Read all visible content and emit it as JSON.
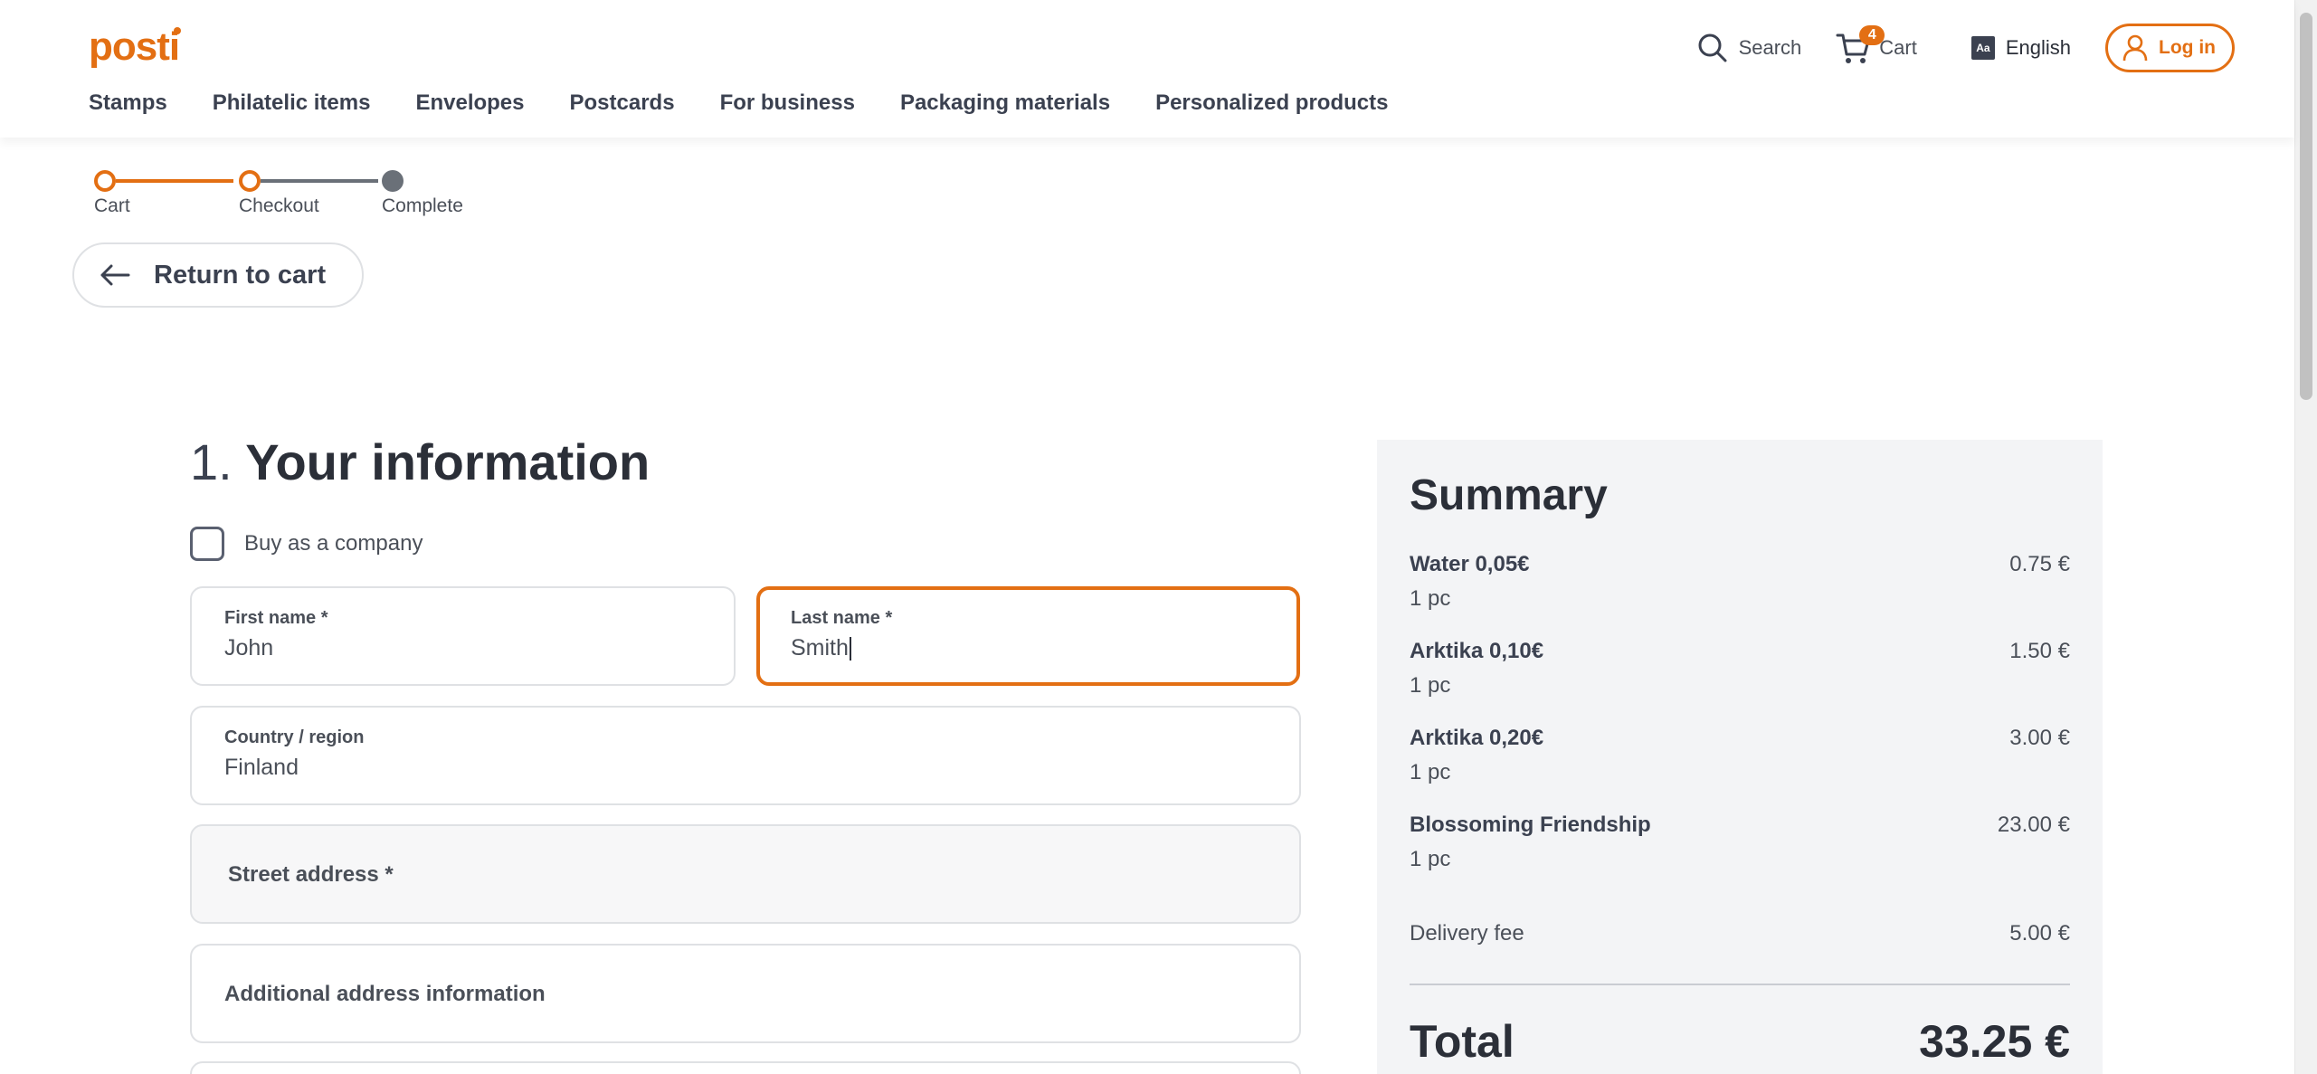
{
  "brand": {
    "logo_text": "posti",
    "accent": "#e36f13"
  },
  "header": {
    "search_label": "Search",
    "cart_label": "Cart",
    "cart_count": "4",
    "language_icon_text": "Aa",
    "language_label": "English",
    "login_label": "Log in"
  },
  "nav": {
    "items": [
      {
        "label": "Stamps"
      },
      {
        "label": "Philatelic items"
      },
      {
        "label": "Envelopes"
      },
      {
        "label": "Postcards"
      },
      {
        "label": "For business"
      },
      {
        "label": "Packaging materials"
      },
      {
        "label": "Personalized products"
      }
    ]
  },
  "stepper": {
    "steps": [
      {
        "label": "Cart",
        "state": "done"
      },
      {
        "label": "Checkout",
        "state": "current"
      },
      {
        "label": "Complete",
        "state": "upcoming"
      }
    ]
  },
  "return_button": {
    "label": "Return to cart"
  },
  "form": {
    "section_number": "1.",
    "section_title": "Your information",
    "company_checkbox": {
      "label": "Buy as a company",
      "checked": false
    },
    "first_name": {
      "label": "First name *",
      "value": "John"
    },
    "last_name": {
      "label": "Last name *",
      "value": "Smith"
    },
    "country": {
      "label": "Country / region",
      "value": "Finland"
    },
    "street": {
      "label": "Street address *"
    },
    "additional": {
      "label": "Additional address information"
    }
  },
  "summary": {
    "title": "Summary",
    "items": [
      {
        "name": "Water 0,05€",
        "qty": "1 pc",
        "price": "0.75 €"
      },
      {
        "name": "Arktika 0,10€",
        "qty": "1 pc",
        "price": "1.50 €"
      },
      {
        "name": "Arktika 0,20€",
        "qty": "1 pc",
        "price": "3.00 €"
      },
      {
        "name": "Blossoming Friendship",
        "qty": "1 pc",
        "price": "23.00 €"
      }
    ],
    "delivery_fee_label": "Delivery fee",
    "delivery_fee": "5.00 €",
    "total_label": "Total",
    "total": "33.25 €"
  }
}
